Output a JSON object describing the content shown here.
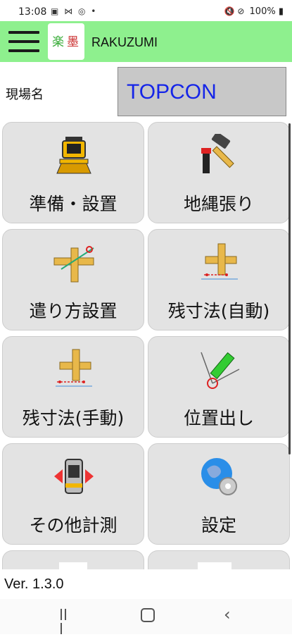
{
  "status_bar": {
    "time": "13:08",
    "notif_icons": "▣ ⋈ ◎ •",
    "right_icons": "🔇 ⊘",
    "battery": "100%"
  },
  "app_bar": {
    "title": "RAKUZUMI"
  },
  "site": {
    "label": "現場名",
    "value": "TOPCON"
  },
  "tiles": [
    {
      "label": "準備・設置",
      "icon": "total-station-icon"
    },
    {
      "label": "地縄張り",
      "icon": "hammer-stake-icon"
    },
    {
      "label": "遣り方設置",
      "icon": "batter-board-icon"
    },
    {
      "label": "残寸法(自動)",
      "icon": "batter-board-auto-icon"
    },
    {
      "label": "残寸法(手動)",
      "icon": "batter-board-manual-icon"
    },
    {
      "label": "位置出し",
      "icon": "pen-position-icon"
    },
    {
      "label": "その他計測",
      "icon": "instrument-rotate-icon"
    },
    {
      "label": "設定",
      "icon": "globe-gear-icon"
    }
  ],
  "footer": {
    "version": "Ver. 1.3.0"
  },
  "colors": {
    "app_bar": "#8ef08e",
    "site_value": "#1525e8",
    "tile_bg": "#e3e3e3"
  }
}
